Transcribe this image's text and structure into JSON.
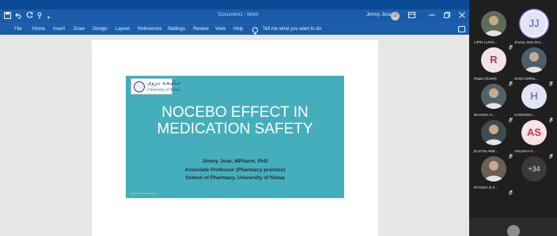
{
  "word": {
    "doc_title": "Document1 - Word",
    "user_name": "Jimmy Jose",
    "user_initials": "JJ",
    "ribbon_tabs": [
      "File",
      "Home",
      "Insert",
      "Draw",
      "Design",
      "Layout",
      "References",
      "Mailings",
      "Review",
      "View",
      "Help"
    ],
    "tell_me": "Tell me what you want to do",
    "icons": {
      "save": "save-icon",
      "undo": "undo-icon",
      "redo": "redo-icon",
      "touch": "touch-mode-icon",
      "customize": "customize-qat-icon",
      "ribbon_options": "ribbon-display-icon",
      "minimize": "minimize-icon",
      "restore": "restore-icon",
      "close": "close-icon",
      "tell_me": "lightbulb-icon",
      "comments": "comments-icon"
    }
  },
  "slide": {
    "logo_arabic": "جـامـعـة نـزوى",
    "logo_english": "University of Nizwa",
    "title_line1": "NOCEBO EFFECT IN",
    "title_line2": "MEDICATION SAFETY",
    "presenter_name": "Jimmy Jose, MPharm, PhD",
    "presenter_role": "Associate Professor (Pharmacy practice)",
    "presenter_school": "School of Pharmacy, University of Nizwa",
    "footer": "Jimmy Jose (unizwa.edu.om)",
    "colors": {
      "background": "#45aebc",
      "title": "#ffffff"
    }
  },
  "participants": [
    {
      "name": "LIPIN LUKO...",
      "type": "photo",
      "muted": true
    },
    {
      "name": "Jimmy Jose (Gu...",
      "type": "initials",
      "initials": "JJ",
      "selected": true
    },
    {
      "name": "Rajan (Guest)",
      "type": "initials",
      "initials": "R",
      "muted": true
    },
    {
      "name": "Sonal Sekha...",
      "type": "photo",
      "muted": true
    },
    {
      "name": "BHAVNA H...",
      "type": "photo",
      "muted": true
    },
    {
      "name": "HARSHIKA ...",
      "type": "initials",
      "initials": "H",
      "muted": true
    },
    {
      "name": "ELSTIN ANB...",
      "type": "photo",
      "muted": true
    },
    {
      "name": "ANUSHA S...",
      "type": "initials",
      "initials": "AS",
      "muted": true
    },
    {
      "name": "RIYONA D S...",
      "type": "photo",
      "muted": true
    },
    {
      "name": "",
      "type": "more",
      "initials": "+34"
    }
  ],
  "colors": {
    "titlebar": "#1b5caa",
    "desktop": "#0b4a94",
    "panel": "#1f1f1f",
    "selected_ring": "#7b83eb"
  }
}
